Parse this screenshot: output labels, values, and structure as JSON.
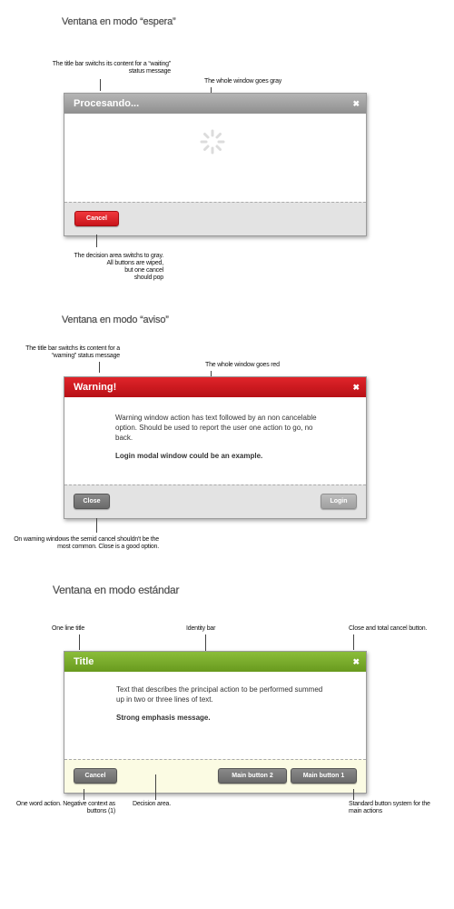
{
  "section_gray": {
    "heading": "Ventana en modo “espera”",
    "ann_titlebar": "The title bar switchs its content for a “waiting” status message",
    "ann_window": "The whole window goes gray",
    "ann_decision_1": "The decision area switchs to gray.",
    "ann_decision_2": "All buttons are wiped,",
    "ann_decision_3": "but one cancel",
    "ann_decision_4": "should pop",
    "window": {
      "title": "Procesando...",
      "close": "✖",
      "cancel": "Cancel"
    }
  },
  "section_warning": {
    "heading": "Ventana en modo “aviso”",
    "ann_titlebar": "The title bar switchs its content for a “warning” status message",
    "ann_window": "The whole window goes red",
    "ann_decision": "On warning windows the semid cancel shouldn't be the most common. Close is a good option.",
    "window": {
      "title": "Warning!",
      "close": "✖",
      "text": "Warning window action has text followed by an non cancelable option. Should be used to report the user one action to go, no back.",
      "emphasis": "Login modal window could be an example.",
      "close_button": "Close",
      "login_button": "Login"
    }
  },
  "section_standard": {
    "heading": "Ventana en modo estándar",
    "ann_title": "One line title",
    "ann_identity": "Identity bar",
    "ann_close": "Close and total cancel button.",
    "ann_negative": "One word action. Negative context as buttons (1)",
    "ann_decision": "Decision area.",
    "ann_standard": "Standard button system for the main actions",
    "window": {
      "title": "Title",
      "close": "✖",
      "text": "Text that describes the principal action to be performed summed up in two or three lines of text.",
      "emphasis": "Strong emphasis message.",
      "cancel": "Cancel",
      "main2": "Main button 2",
      "main1": "Main button 1"
    }
  }
}
